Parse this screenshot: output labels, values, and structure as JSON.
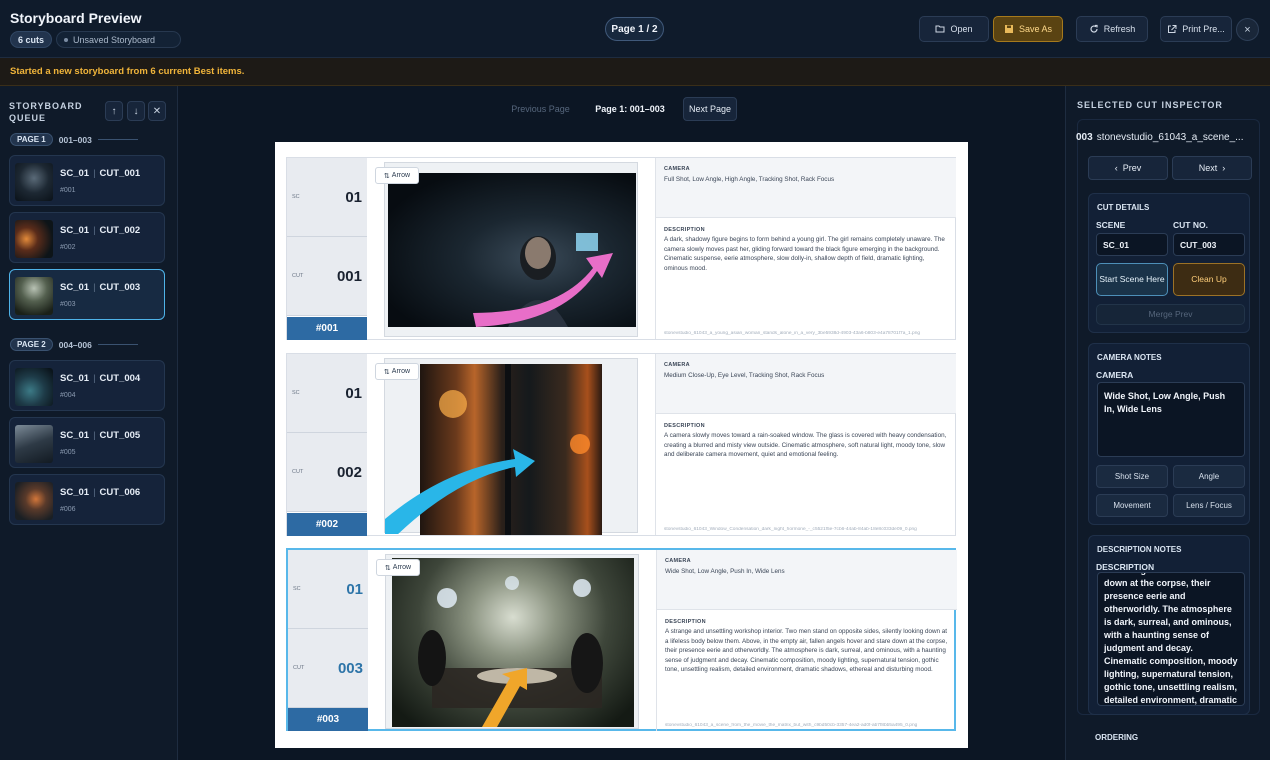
{
  "app": {
    "title": "Storyboard Preview",
    "cuts_badge": "6 cuts",
    "status_chip": "Unsaved Storyboard",
    "page_indicator": "Page 1 / 2"
  },
  "toolbar": {
    "open": "Open",
    "save_as": "Save As",
    "refresh": "Refresh",
    "print": "Print Pre...",
    "close": "×"
  },
  "banner": "Started a new storyboard from 6 current Best items.",
  "queue": {
    "title": "STORYBOARD QUEUE",
    "pages": [
      {
        "badge": "PAGE 1",
        "range": "001–003"
      },
      {
        "badge": "PAGE 2",
        "range": "004–006"
      }
    ],
    "items": [
      {
        "scene": "SC_01",
        "cut": "CUT_001",
        "num": "#001",
        "selected": false
      },
      {
        "scene": "SC_01",
        "cut": "CUT_002",
        "num": "#002",
        "selected": false
      },
      {
        "scene": "SC_01",
        "cut": "CUT_003",
        "num": "#003",
        "selected": true
      },
      {
        "scene": "SC_01",
        "cut": "CUT_004",
        "num": "#004",
        "selected": false
      },
      {
        "scene": "SC_01",
        "cut": "CUT_005",
        "num": "#005",
        "selected": false
      },
      {
        "scene": "SC_01",
        "cut": "CUT_006",
        "num": "#006",
        "selected": false
      }
    ]
  },
  "pager": {
    "prev": "Previous Page",
    "current": "Page 1: 001–003",
    "next": "Next Page"
  },
  "sheet": {
    "sc_label": "SC",
    "cut_label": "CUT",
    "arrow_tag": "Arrow",
    "camera_title": "CAMERA",
    "desc_title": "DESCRIPTION",
    "rows": [
      {
        "sc": "01",
        "cut": "001",
        "cut_no": "#001",
        "camera": "Full Shot, Low Angle, High Angle, Tracking Shot, Rack Focus",
        "description": "A dark, shadowy figure begins to form behind a young girl. The girl remains completely unaware. The camera slowly moves past her, gliding forward toward the black figure emerging in the background. Cinematic suspense, eerie atmosphere, slow dolly-in, shallow depth of field, dramatic lighting, ominous mood.",
        "filename": "stonevstudio_61043_a_young_asian_woman_stands_alone_in_a_very_3be5938d-4903-43a6-b803-e4a78701f7a_1.png",
        "arrow_color": "#e86ec8",
        "selected": false
      },
      {
        "sc": "01",
        "cut": "002",
        "cut_no": "#002",
        "camera": "Medium Close-Up, Eye Level, Tracking Shot, Rack Focus",
        "description": "A camera slowly moves toward a rain-soaked window. The glass is covered with heavy condensation, creating a blurred and misty view outside. Cinematic atmosphere, soft natural light, moody tone, slow and deliberate camera movement, quiet and emotional feeling.",
        "filename": "stonevstudio_61043_Window_Condensation_dark_night_hormone_-_c5521f5e-7cb6-44ab-84ab-18e8c033de09_0.png",
        "arrow_color": "#29b6e8",
        "selected": false
      },
      {
        "sc": "01",
        "cut": "003",
        "cut_no": "#003",
        "camera": "Wide Shot, Low Angle, Push In, Wide Lens",
        "description": "A strange and unsettling workshop interior. Two men stand on opposite sides, silently looking down at a lifeless body below them. Above, in the empty air, fallen angels hover and stare down at the corpse, their presence eerie and otherworldly. The atmosphere is dark, surreal, and ominous, with a haunting sense of judgment and decay. Cinematic composition, moody lighting, supernatural tension, gothic tone, unsettling realism, detailed environment, dramatic shadows, ethereal and disturbing mood.",
        "filename": "stonevstudio_61043_a_scene_from_the_movie_the_matrix_but_with_c9bd50cb-3357-4ea2-ad0f-ab7f8bb5a495_0.png",
        "arrow_color": "#f0a62a",
        "selected": true
      }
    ]
  },
  "inspector": {
    "title": "SELECTED CUT INSPECTOR",
    "header_num": "003",
    "header_name": "stonevstudio_61043_a_scene_...",
    "prev": "Prev",
    "next": "Next",
    "details_title": "CUT DETAILS",
    "scene_label": "SCENE",
    "scene_value": "SC_01",
    "cutno_label": "CUT NO.",
    "cutno_value": "CUT_003",
    "start_scene": "Start Scene Here",
    "clean_up": "Clean Up",
    "merge_prev": "Merge Prev",
    "camera_notes_title": "CAMERA NOTES",
    "camera_label": "CAMERA",
    "camera_value": "Wide Shot, Low Angle, Push In, Wide Lens",
    "shot_size": "Shot Size",
    "angle": "Angle",
    "movement": "Movement",
    "lens_focus": "Lens / Focus",
    "desc_notes_title": "DESCRIPTION NOTES",
    "desc_label": "DESCRIPTION",
    "desc_value": "fallen angels hover and stare down at the corpse, their presence eerie and otherworldly. The atmosphere is dark, surreal, and ominous, with a haunting sense of judgment and decay. Cinematic composition, moody lighting, supernatural tension, gothic tone, unsettling realism, detailed environment, dramatic shadows, ethereal and disturbing mood.",
    "ordering_title": "ORDERING"
  },
  "colors": {
    "accent": "#4fb3e8",
    "save": "#a67a1c",
    "banner_text": "#f0b43a",
    "cut_bar": "#2d6aa3"
  }
}
